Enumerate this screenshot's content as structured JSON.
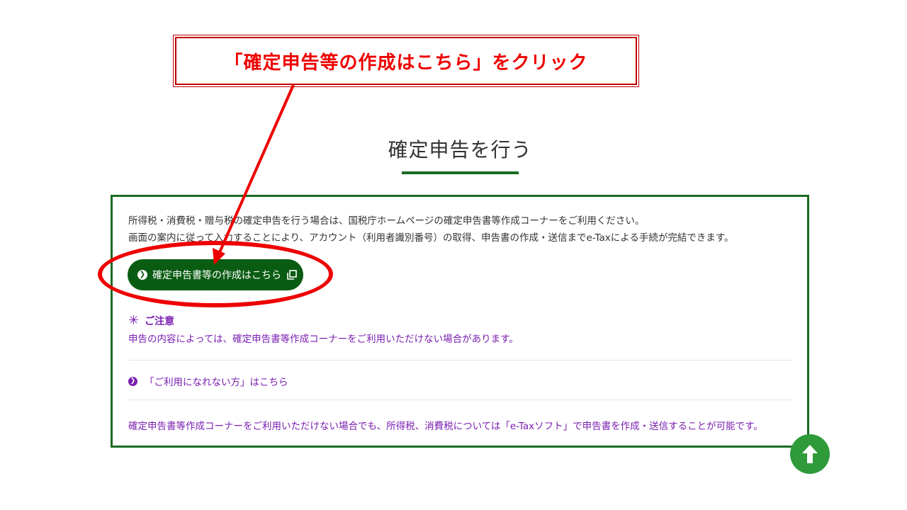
{
  "callout": {
    "text": "「確定申告等の作成はこちら」をクリック"
  },
  "section": {
    "title": "確定申告を行う"
  },
  "panel": {
    "intro_line1": "所得税・消費税・贈与税の確定申告を行う場合は、国税庁ホームページの確定申告書等作成コーナーをご利用ください。",
    "intro_line2": "画面の案内に従って入力することにより、アカウント（利用者識別番号）の取得、申告書の作成・送信までe-Taxによる手続が完結できます。",
    "cta_label": "確定申告書等の作成はこちら",
    "notice_title": "ご注意",
    "notice_text": "申告の内容によっては、確定申告書等作成コーナーをご利用いただけない場合があります。",
    "link_label": "「ご利用になれない方」はこちら",
    "footer_note": "確定申告書等作成コーナーをご利用いただけない場合でも、所得税、消費税については「e-Taxソフト」で申告書を作成・送信することが可能です。"
  },
  "icons": {
    "chevron": "chevron-right-icon",
    "external": "external-window-icon",
    "asterisk": "asterisk-icon",
    "to_top": "arrow-up-icon"
  },
  "colors": {
    "brand_green": "#1a6b22",
    "button_green": "#0a5c12",
    "notice_purple": "#7a1fb0",
    "annotation_red": "#ee0000",
    "to_top_green": "#2e9a3a"
  }
}
